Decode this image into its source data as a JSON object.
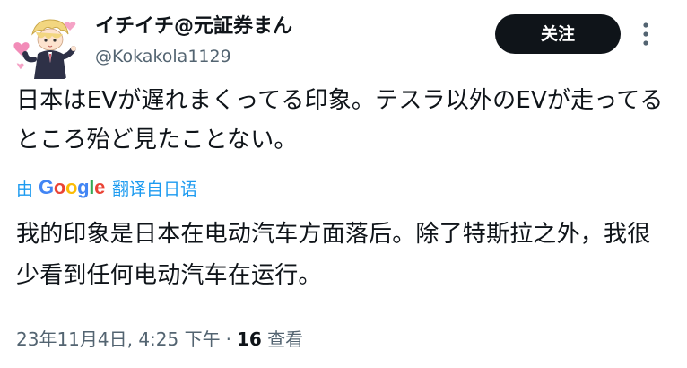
{
  "author": {
    "display_name": "イチイチ@元証券まん",
    "handle": "@Kokakola1129"
  },
  "follow_button": {
    "label": "关注"
  },
  "more_button": {
    "icon": "vertical-ellipsis-icon"
  },
  "tweet": {
    "text": "日本はEVが遅れまくってる印象。テスラ以外のEVが走ってるところ殆ど見たことない。"
  },
  "translation": {
    "by": "由",
    "provider": "Google",
    "action": "翻译自日语",
    "text": "我的印象是日本在电动汽车方面落后。除了特斯拉之外，我很少看到任何电动汽车在运行。"
  },
  "meta": {
    "timestamp": "23年11月4日, 4:25 下午",
    "separator": "·",
    "views_count": "16",
    "views_label": "查看"
  },
  "colors": {
    "text": "#0f1419",
    "secondary": "#536471",
    "link": "#1d9bf0",
    "button_bg": "#0f1419",
    "button_text": "#ffffff"
  }
}
